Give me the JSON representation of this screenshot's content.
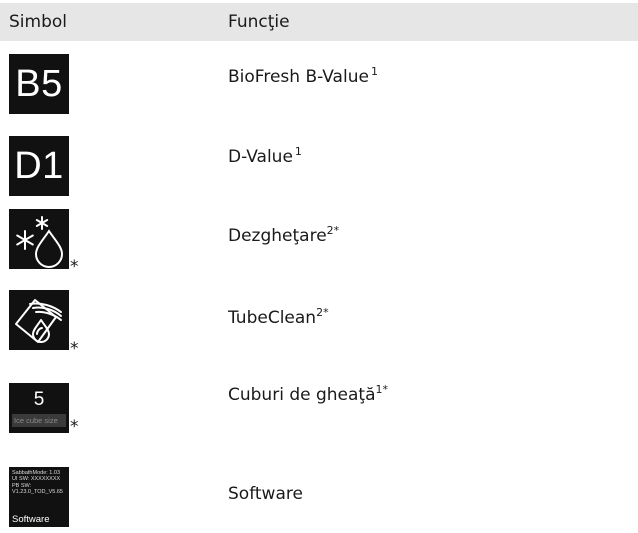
{
  "header": {
    "col_symbol": "Simbol",
    "col_function": "Funcţie"
  },
  "rows": [
    {
      "symbol_text": "B5",
      "function": "BioFresh B-Value",
      "sup": "1",
      "star": ""
    },
    {
      "symbol_text": "D1",
      "function": "D-Value",
      "sup": "1",
      "star": ""
    },
    {
      "symbol_icon": "snowflake-drop-icon",
      "function": "Dezgheţare",
      "sup": "2*",
      "star": "*"
    },
    {
      "symbol_icon": "tube-clean-icon",
      "function": "TubeClean",
      "sup": "2*",
      "star": "*"
    },
    {
      "symbol_number": "5",
      "symbol_bar_text": "Ice cube size",
      "function": "Cuburi de gheaţă",
      "sup": "1*",
      "star": "*"
    },
    {
      "symbol_lines": "SabbathMode: 1.03\nUI SW: XXXXXXXX\nPB SW:\nV1.23.0_TOD_V5.65",
      "symbol_label": "Software",
      "function": "Software",
      "sup": "",
      "star": ""
    }
  ]
}
